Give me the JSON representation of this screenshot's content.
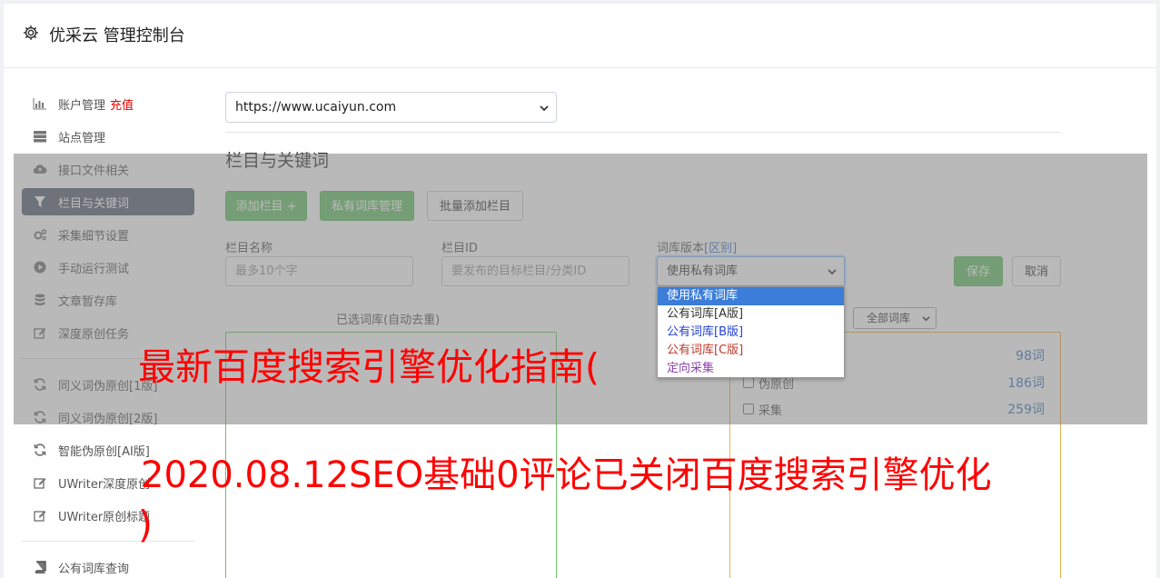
{
  "header": {
    "title": "优采云 管理控制台"
  },
  "sidebar": {
    "items": [
      {
        "label": "账户管理",
        "extra": "充值",
        "icon": "bar-chart-icon"
      },
      {
        "label": "站点管理",
        "icon": "server-icon"
      },
      {
        "label": "接口文件相关",
        "icon": "cloud-upload-icon"
      },
      {
        "label": "栏目与关键词",
        "icon": "filter-icon",
        "active": true
      },
      {
        "label": "采集细节设置",
        "icon": "gears-icon"
      },
      {
        "label": "手动运行测试",
        "icon": "play-circle-icon"
      },
      {
        "label": "文章暂存库",
        "icon": "database-icon"
      },
      {
        "label": "深度原创任务",
        "icon": "edit-icon"
      },
      {
        "label": "同义词伪原创[1版]",
        "icon": "refresh-icon"
      },
      {
        "label": "同义词伪原创[2版]",
        "icon": "refresh-icon"
      },
      {
        "label": "智能伪原创[AI版]",
        "icon": "refresh-icon"
      },
      {
        "label": "UWriter深度原创",
        "icon": "edit-icon"
      },
      {
        "label": "UWriter原创标题",
        "icon": "edit-icon"
      },
      {
        "label": "公有词库查询",
        "icon": "book-icon"
      }
    ]
  },
  "main": {
    "site_select": {
      "value": "https://www.ucaiyun.com"
    },
    "section_title": "栏目与关键词",
    "buttons": {
      "add_column": "添加栏目 +",
      "private_lib": "私有词库管理",
      "batch_add": "批量添加栏目",
      "save": "保存",
      "cancel": "取消"
    },
    "form": {
      "name_label": "栏目名称",
      "name_placeholder": "最多10个字",
      "id_label": "栏目ID",
      "id_placeholder": "要发布的目标栏目/分类ID",
      "version_label": "词库版本",
      "version_link": "[区别]",
      "version_value": "使用私有词库"
    },
    "dropdown_options": [
      {
        "label": "使用私有词库",
        "color": "#ffffff"
      },
      {
        "label": "公有词库[A版]",
        "color": "#333333"
      },
      {
        "label": "公有词库[B版]",
        "color": "#1f3fd0"
      },
      {
        "label": "公有词库[C版]",
        "color": "#c0392b"
      },
      {
        "label": "定向采集",
        "color": "#8e44ad"
      }
    ],
    "selected_caption": "已选词库(自动去重)",
    "filter_select": "全部词库",
    "libraries": [
      {
        "label": "",
        "count": "98词"
      },
      {
        "label": "伪原创",
        "count": "186词"
      },
      {
        "label": "采集",
        "count": "259词"
      }
    ]
  },
  "watermark": {
    "line1": "最新百度搜索引擎优化指南(",
    "line2": "2020.08.12SEO基础0评论已关闭百度搜索引擎优化",
    "line3": ")"
  }
}
